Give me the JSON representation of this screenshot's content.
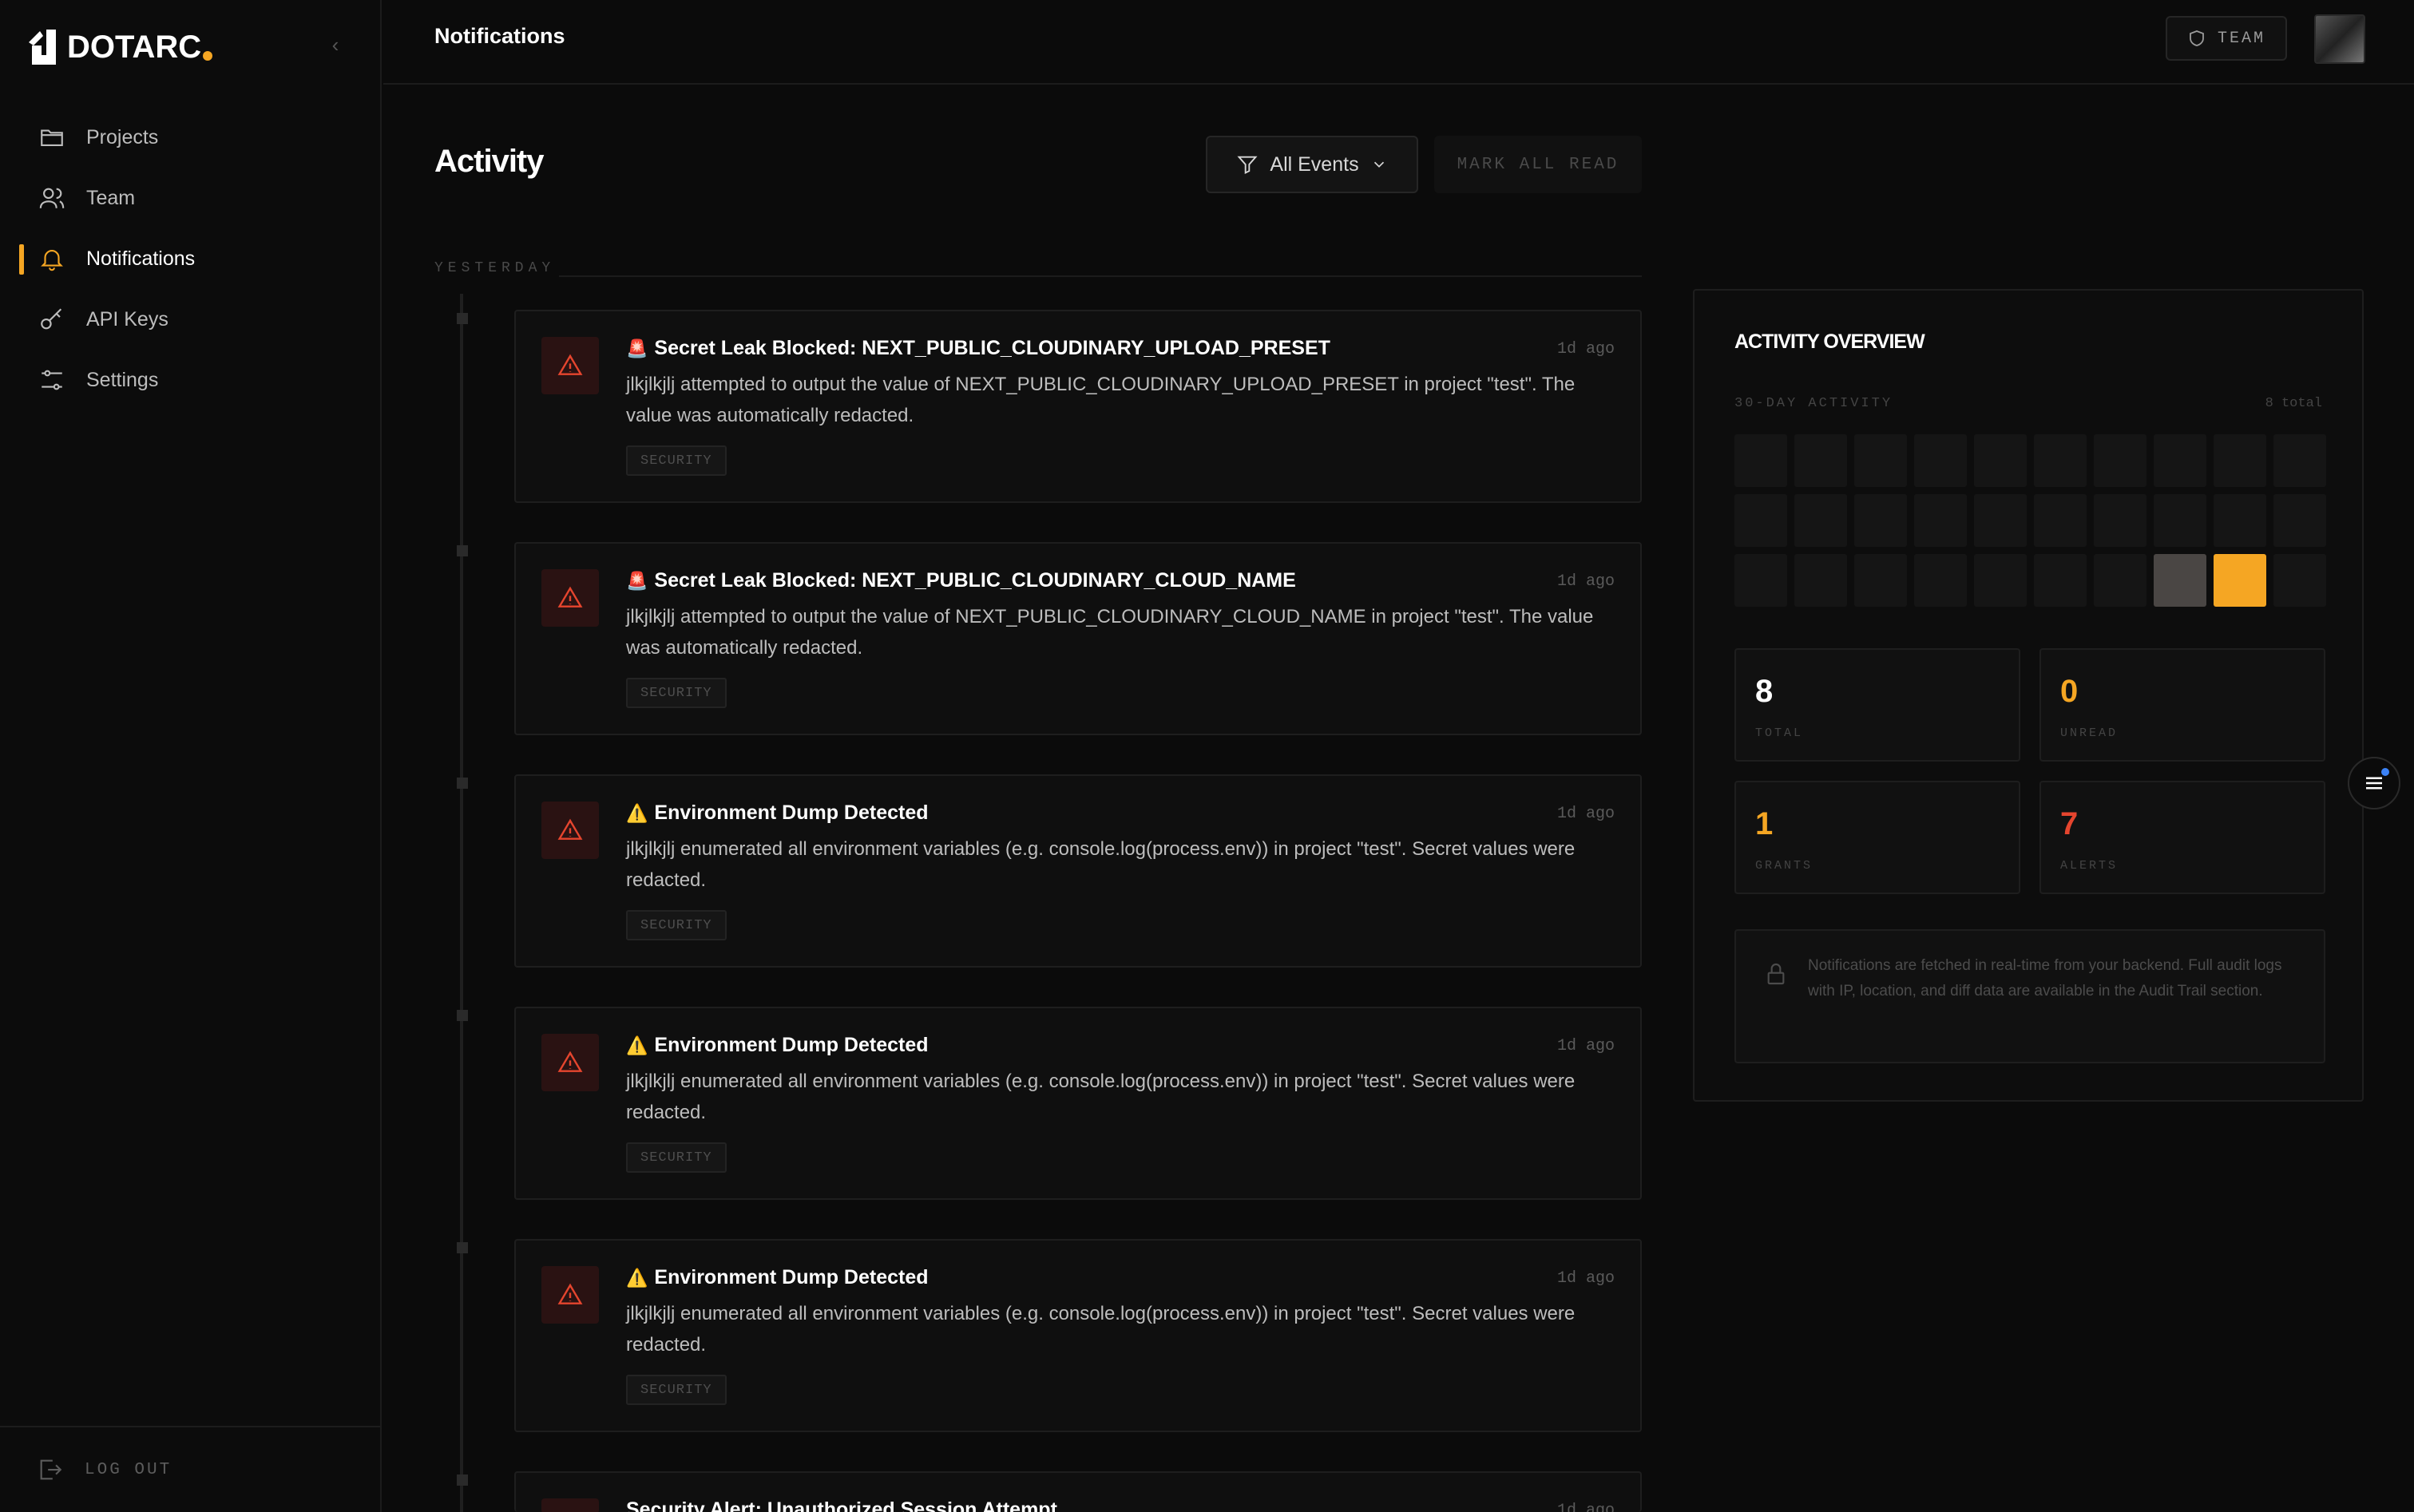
{
  "brand": {
    "name": "DOTARC",
    "accent": "#f5a623"
  },
  "sidebar": {
    "items": [
      {
        "label": "Projects",
        "icon": "folder-icon"
      },
      {
        "label": "Team",
        "icon": "users-icon"
      },
      {
        "label": "Notifications",
        "icon": "bell-icon",
        "active": true
      },
      {
        "label": "API Keys",
        "icon": "key-icon"
      },
      {
        "label": "Settings",
        "icon": "sliders-icon"
      }
    ],
    "logout_label": "LOG OUT"
  },
  "header": {
    "title": "Notifications",
    "team_label": "TEAM"
  },
  "main": {
    "title": "Activity",
    "filter_label": "All Events",
    "mark_all_label": "MARK ALL READ",
    "group_label": "YESTERDAY",
    "events": [
      {
        "emoji": "🚨",
        "title": "Secret Leak Blocked: NEXT_PUBLIC_CLOUDINARY_UPLOAD_PRESET",
        "time": "1d ago",
        "desc": "jlkjlkjlj attempted to output the value of NEXT_PUBLIC_CLOUDINARY_UPLOAD_PRESET in project \"test\". The value was automatically redacted.",
        "tag": "SECURITY"
      },
      {
        "emoji": "🚨",
        "title": "Secret Leak Blocked: NEXT_PUBLIC_CLOUDINARY_CLOUD_NAME",
        "time": "1d ago",
        "desc": "jlkjlkjlj attempted to output the value of NEXT_PUBLIC_CLOUDINARY_CLOUD_NAME in project \"test\". The value was automatically redacted.",
        "tag": "SECURITY"
      },
      {
        "emoji": "⚠️",
        "title": "Environment Dump Detected",
        "time": "1d ago",
        "desc": "jlkjlkjlj enumerated all environment variables (e.g. console.log(process.env)) in project \"test\". Secret values were redacted.",
        "tag": "SECURITY"
      },
      {
        "emoji": "⚠️",
        "title": "Environment Dump Detected",
        "time": "1d ago",
        "desc": "jlkjlkjlj enumerated all environment variables (e.g. console.log(process.env)) in project \"test\". Secret values were redacted.",
        "tag": "SECURITY"
      },
      {
        "emoji": "⚠️",
        "title": "Environment Dump Detected",
        "time": "1d ago",
        "desc": "jlkjlkjlj enumerated all environment variables (e.g. console.log(process.env)) in project \"test\". Secret values were redacted.",
        "tag": "SECURITY"
      },
      {
        "emoji": "",
        "title": "Security Alert: Unauthorized Session Attempt",
        "time": "1d ago",
        "desc": "",
        "tag": ""
      }
    ]
  },
  "overview": {
    "title": "ACTIVITY OVERVIEW",
    "subtitle": "30-DAY ACTIVITY",
    "count_label": "8 total",
    "heatmap_levels": [
      0,
      0,
      0,
      0,
      0,
      0,
      0,
      0,
      0,
      0,
      0,
      0,
      0,
      0,
      0,
      0,
      0,
      0,
      0,
      0,
      0,
      0,
      0,
      0,
      0,
      0,
      0,
      1,
      2,
      0
    ],
    "stats": [
      {
        "value": "8",
        "label": "TOTAL",
        "color": "#ffffff"
      },
      {
        "value": "0",
        "label": "UNREAD",
        "color": "#f5a623"
      },
      {
        "value": "1",
        "label": "GRANTS",
        "color": "#f5a623"
      },
      {
        "value": "7",
        "label": "ALERTS",
        "color": "#e5452e"
      }
    ],
    "info_text": "Notifications are fetched in real-time from your backend. Full audit logs with IP, location, and diff data are available in the Audit Trail section."
  }
}
